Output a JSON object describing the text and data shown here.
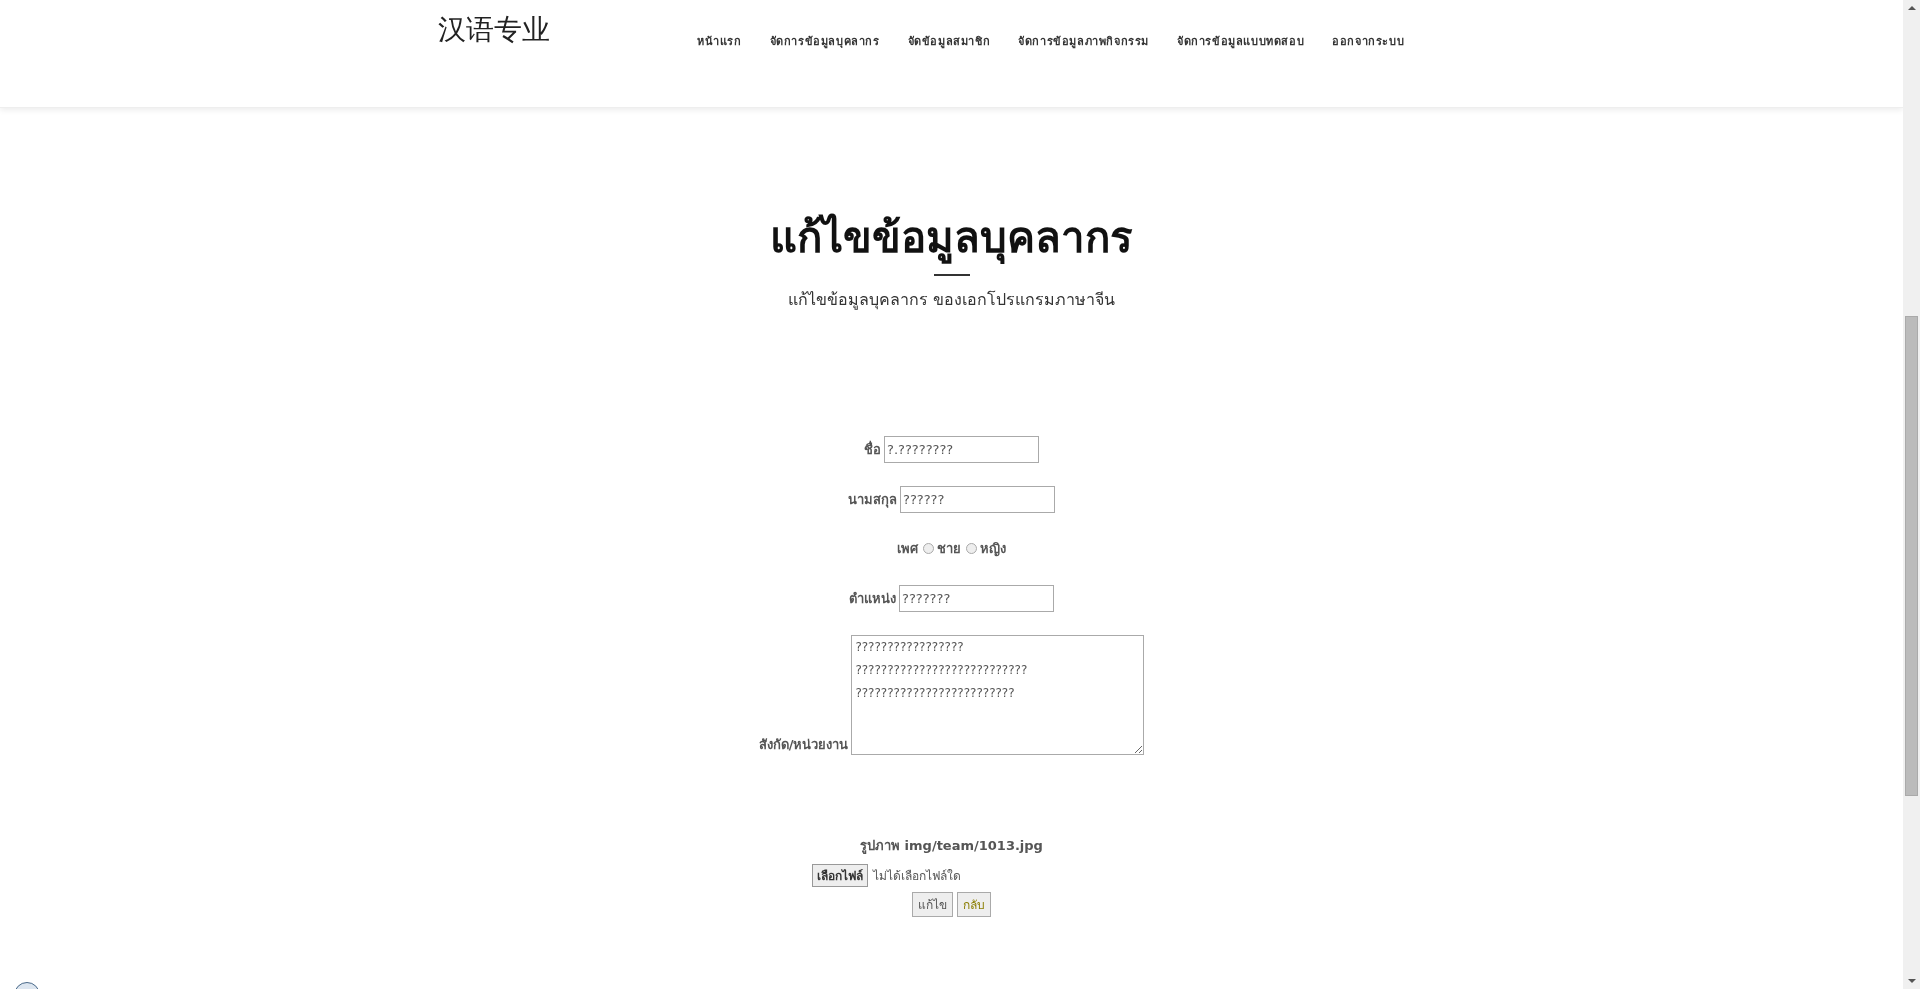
{
  "header": {
    "logo": "汉语专业",
    "nav": [
      {
        "label": "หน้าแรก"
      },
      {
        "label": "จัดการข้อมูลบุคลากร"
      },
      {
        "label": "จัดข้อมูลสมาชิก"
      },
      {
        "label": "จัดการข้อมูลภาพกิจกรรม"
      },
      {
        "label": "จัดการข้อมูลแบบทดสอบ"
      },
      {
        "label": "ออกจากระบบ"
      }
    ]
  },
  "page": {
    "title": "แก้ไขข้อมูลบุคลากร",
    "subtitle": "แก้ไขข้อมูลบุคลากร ของเอกโปรแกรมภาษาจีน"
  },
  "form": {
    "fields": [
      {
        "kind": "text",
        "label": "ชื่อ",
        "value": "?.????????"
      },
      {
        "kind": "text",
        "label": "นามสกุล",
        "value": "??????"
      },
      {
        "kind": "radio",
        "label": "เพศ",
        "options": [
          {
            "label": "ชาย",
            "selected": false
          },
          {
            "label": "หญิง",
            "selected": false
          }
        ]
      },
      {
        "kind": "text",
        "label": "ตำแหน่ง",
        "value": "???????"
      },
      {
        "kind": "textarea",
        "label": "สังกัด/หน่วยงาน",
        "value": "?????????????????\n???????????????????????????\n?????????????????????????"
      }
    ],
    "image": {
      "label": "รูปภาพ img/team/1013.jpg"
    },
    "file": {
      "button": "เลือกไฟล์",
      "status": "ไม่ได้เลือกไฟล์ใด"
    },
    "buttons": [
      {
        "kind": "submit",
        "label": "แก้ไข"
      },
      {
        "kind": "back",
        "label": "กลับ"
      }
    ]
  }
}
